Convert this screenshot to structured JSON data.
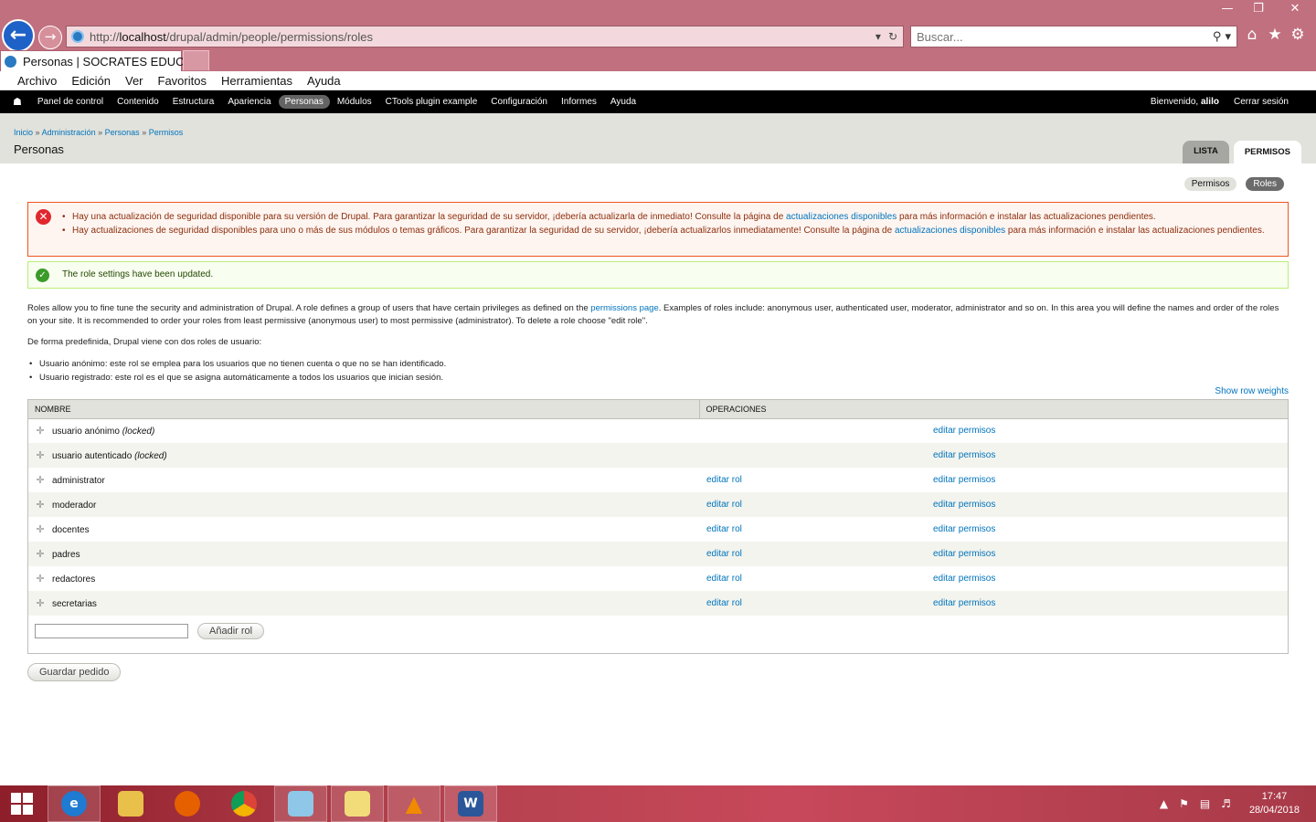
{
  "browser": {
    "url_prefix": "http://",
    "url_host": "localhost",
    "url_path": "/drupal/admin/people/permissions/roles",
    "search_placeholder": "Buscar...",
    "tab_title": "Personas | SOCRATES EDUCA",
    "menu": [
      "Archivo",
      "Edición",
      "Ver",
      "Favoritos",
      "Herramientas",
      "Ayuda"
    ]
  },
  "toolbar": {
    "items": [
      "Panel de control",
      "Contenido",
      "Estructura",
      "Apariencia",
      "Personas",
      "Módulos",
      "CTools plugin example",
      "Configuración",
      "Informes",
      "Ayuda"
    ],
    "active_item": "Personas",
    "welcome_prefix": "Bienvenido,",
    "username": "alilo",
    "logout": "Cerrar sesión"
  },
  "header": {
    "breadcrumb": [
      "Inicio",
      "Administración",
      "Personas",
      "Permisos"
    ],
    "breadcrumb_sep": "»",
    "title": "Personas",
    "tabs": [
      "LISTA",
      "PERMISOS"
    ],
    "active_tab": "PERMISOS"
  },
  "secondary_tabs": [
    "Permisos",
    "Roles"
  ],
  "messages": {
    "error_1_before": "Hay una actualización de seguridad disponible para su versión de Drupal. Para garantizar la seguridad de su servidor, ¡debería actualizarla de inmediato! Consulte la página de ",
    "error_1_link": "actualizaciones disponibles",
    "error_1_after": " para más información e instalar las actualizaciones pendientes.",
    "error_2_before": "Hay actualizaciones de seguridad disponibles para uno o más de sus módulos o temas gráficos. Para garantizar la seguridad de su servidor, ¡debería actualizarlos inmediatamente! Consulte la página de ",
    "error_2_link": "actualizaciones disponibles",
    "error_2_after": " para más información e instalar las actualizaciones pendientes.",
    "status": "The role settings have been updated."
  },
  "help": {
    "p1_before": "Roles allow you to fine tune the security and administration of Drupal. A role defines a group of users that have certain privileges as defined on the ",
    "p1_link": "permissions page",
    "p1_after": ". Examples of roles include: anonymous user, authenticated user, moderator, administrator and so on. In this area you will define the names and order of the roles on your site. It is recommended to order your roles from least permissive (anonymous user) to most permissive (administrator). To delete a role choose \"edit role\".",
    "p2": "De forma predefinida, Drupal viene con dos roles de usuario:",
    "list": [
      "Usuario anónimo: este rol se emplea para los usuarios que no tienen cuenta o que no se han identificado.",
      "Usuario registrado: este rol es el que se asigna automáticamente a todos los usuarios que inician sesión."
    ]
  },
  "table": {
    "show_weights": "Show row weights",
    "col_name": "NOMBRE",
    "col_ops": "OPERACIONES",
    "locked_label": "(locked)",
    "edit_role": "editar rol",
    "edit_perms": "editar permisos",
    "rows": [
      {
        "name": "usuario anónimo",
        "locked": true
      },
      {
        "name": "usuario autenticado",
        "locked": true
      },
      {
        "name": "administrator",
        "locked": false
      },
      {
        "name": "moderador",
        "locked": false
      },
      {
        "name": "docentes",
        "locked": false
      },
      {
        "name": "padres",
        "locked": false
      },
      {
        "name": "redactores",
        "locked": false
      },
      {
        "name": "secretarias",
        "locked": false
      }
    ],
    "add_button": "Añadir rol",
    "save_button": "Guardar pedido"
  },
  "taskbar": {
    "time": "17:47",
    "date": "28/04/2018"
  },
  "colors": {
    "link": "#0074bd",
    "toolbar": "#000000",
    "error_border": "#ed541d",
    "status_border": "#bbee77",
    "chrome": "#c1707f"
  }
}
